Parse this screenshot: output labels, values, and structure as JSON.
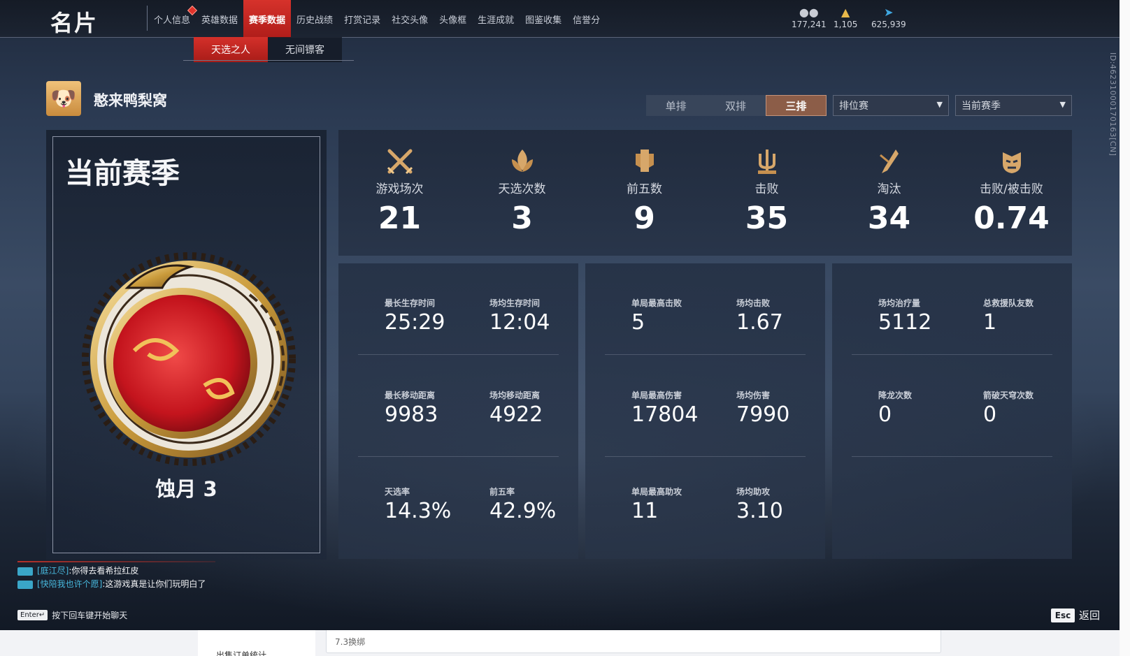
{
  "header": {
    "title": "名片",
    "nav": [
      {
        "label": "个人信息",
        "active": false,
        "dot": true
      },
      {
        "label": "英雄数据",
        "active": false
      },
      {
        "label": "赛季数据",
        "active": true
      },
      {
        "label": "历史战绩",
        "active": false
      },
      {
        "label": "打赏记录",
        "active": false
      },
      {
        "label": "社交头像",
        "active": false
      },
      {
        "label": "头像框",
        "active": false
      },
      {
        "label": "生涯成就",
        "active": false
      },
      {
        "label": "图鉴收集",
        "active": false
      },
      {
        "label": "信誉分",
        "active": false
      }
    ],
    "currencies": [
      {
        "icon": "coin-stack-icon",
        "value": "177,241",
        "color": "#c8ccd4"
      },
      {
        "icon": "gold-ingot-icon",
        "value": "1,105",
        "color": "#e8b84a"
      },
      {
        "icon": "feather-icon",
        "value": "625,939",
        "color": "#3fa7e0"
      }
    ]
  },
  "subnav": [
    {
      "label": "天选之人",
      "active": true
    },
    {
      "label": "无间镖客",
      "active": false
    }
  ],
  "player": {
    "name": "憨来鸭梨窝"
  },
  "filters": {
    "modes": [
      {
        "label": "单排",
        "active": false
      },
      {
        "label": "双排",
        "active": false
      },
      {
        "label": "三排",
        "active": true
      }
    ],
    "match_type": "排位赛",
    "season": "当前赛季"
  },
  "season_card": {
    "title": "当前赛季",
    "rank": "蚀月 3"
  },
  "summary": [
    {
      "icon": "crossed-swords-icon",
      "label": "游戏场次",
      "value": "21"
    },
    {
      "icon": "lotus-flame-icon",
      "label": "天选次数",
      "value": "3"
    },
    {
      "icon": "banner-shield-icon",
      "label": "前五数",
      "value": "9"
    },
    {
      "icon": "trident-icon",
      "label": "击败",
      "value": "35"
    },
    {
      "icon": "broken-blade-icon",
      "label": "淘汰",
      "value": "34"
    },
    {
      "icon": "demon-mask-icon",
      "label": "击败/被击败",
      "value": "0.74"
    }
  ],
  "details": [
    [
      {
        "label": "最长生存时间",
        "value": "25:29"
      },
      {
        "label": "场均生存时间",
        "value": "12:04"
      },
      {
        "label": "最长移动距离",
        "value": "9983"
      },
      {
        "label": "场均移动距离",
        "value": "4922"
      },
      {
        "label": "天选率",
        "value": "14.3%"
      },
      {
        "label": "前五率",
        "value": "42.9%"
      }
    ],
    [
      {
        "label": "单局最高击败",
        "value": "5"
      },
      {
        "label": "场均击败",
        "value": "1.67"
      },
      {
        "label": "单局最高伤害",
        "value": "17804"
      },
      {
        "label": "场均伤害",
        "value": "7990"
      },
      {
        "label": "单局最高助攻",
        "value": "11"
      },
      {
        "label": "场均助攻",
        "value": "3.10"
      }
    ],
    [
      {
        "label": "场均治疗量",
        "value": "5112"
      },
      {
        "label": "总救援队友数",
        "value": "1"
      },
      {
        "label": "降龙次数",
        "value": "0"
      },
      {
        "label": "箭破天穹次数",
        "value": "0"
      }
    ]
  ],
  "chat": {
    "messages": [
      {
        "who": "[庭江尽]",
        "text": ":你得去看希拉红皮"
      },
      {
        "who": "[快陪我也许个愿]",
        "text": ":这游戏真是让你们玩明白了"
      }
    ],
    "hint_key": "Enter↵",
    "hint": "按下回车键开始聊天"
  },
  "esc": {
    "key": "Esc",
    "label": "返回"
  },
  "uid": "ID:46231000170163[CN]",
  "background_page": {
    "left_text": "出售订单统计",
    "mid_text": "7.3换绑"
  }
}
